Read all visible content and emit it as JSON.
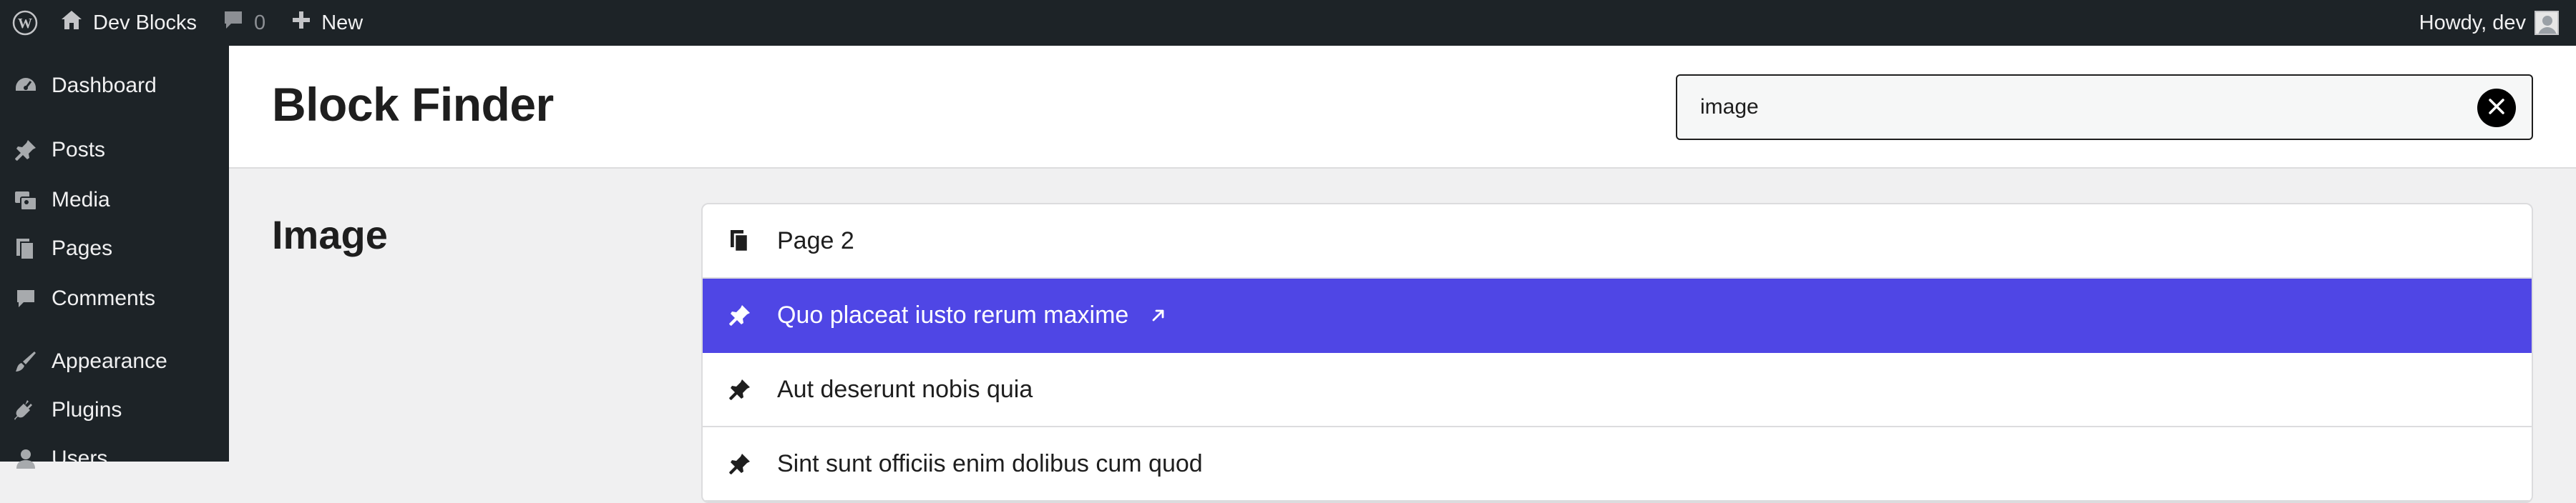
{
  "admin_bar": {
    "wp_logo_icon": "wordpress-logo-icon",
    "site_name": "Dev Blocks",
    "comments_count": "0",
    "new_label": "New",
    "howdy": "Howdy, dev"
  },
  "sidebar": {
    "items": [
      {
        "label": "Dashboard",
        "icon": "dashboard-icon"
      },
      {
        "label": "Posts",
        "icon": "pin-icon"
      },
      {
        "label": "Media",
        "icon": "media-icon"
      },
      {
        "label": "Pages",
        "icon": "pages-icon"
      },
      {
        "label": "Comments",
        "icon": "comment-icon"
      },
      {
        "label": "Appearance",
        "icon": "brush-icon"
      },
      {
        "label": "Plugins",
        "icon": "plugin-icon"
      },
      {
        "label": "Users",
        "icon": "users-icon"
      }
    ]
  },
  "header": {
    "title": "Block Finder",
    "search_value": "image"
  },
  "section": {
    "heading": "Image"
  },
  "results": [
    {
      "label": "Page 2",
      "icon": "page-icon",
      "active": false
    },
    {
      "label": "Quo placeat iusto rerum maxime",
      "icon": "pin-icon",
      "active": true
    },
    {
      "label": "Aut deserunt nobis quia",
      "icon": "pin-icon",
      "active": false
    },
    {
      "label": "Sint sunt officiis enim dolibus cum quod",
      "icon": "pin-icon",
      "active": false
    }
  ],
  "colors": {
    "admin_bg": "#1d2327",
    "accent": "#4f46e5",
    "page_bg": "#f0f0f1"
  }
}
